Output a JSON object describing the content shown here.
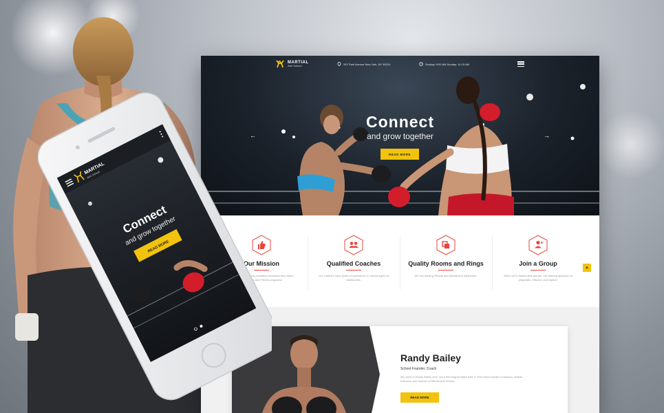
{
  "brand": {
    "name": "MARTIAL",
    "sub": "Arts School"
  },
  "header": {
    "address": "267 Park Avenue New York, NY 90210",
    "hours": "Sunday: 9:00 AM Sunday: 11:15 AM"
  },
  "hero": {
    "title": "Connect",
    "subtitle": "and grow together",
    "button": "READ MORE"
  },
  "features": [
    {
      "title": "Our Mission",
      "desc": "We are committed to providing innovative and varied Martial Arts and Fitness programs.",
      "icon": "thumbs-up-icon"
    },
    {
      "title": "Qualified Coaches",
      "desc": "Our coaches have years of experience in various types of Martial Arts.",
      "icon": "users-icon"
    },
    {
      "title": "Quality Rooms and Rings",
      "desc": "We use leading Fitness and Martial Arts equipment.",
      "icon": "rooms-icon"
    },
    {
      "title": "Join a Group",
      "desc": "Work out in Martial Arts groups. Our training approach is pragmatic, efficient, and explicit.",
      "icon": "add-user-icon"
    }
  ],
  "coach": {
    "name": "Randy Bailey",
    "role": "School Founder, Coach",
    "bio": "My name is Randy Bailey and I am a 6th Degree Black Belt, 5 Time World Karate Champion, Master Instructor and founder of Martial Arts School.",
    "button": "READ MORE"
  },
  "mobile": {
    "brand": "MARTIAL",
    "brand_sub": "Arts School",
    "title": "Connect",
    "subtitle": "and grow together",
    "button": "READ MORE"
  },
  "colors": {
    "accent": "#f2c30c",
    "icon_red": "#e8453c"
  }
}
